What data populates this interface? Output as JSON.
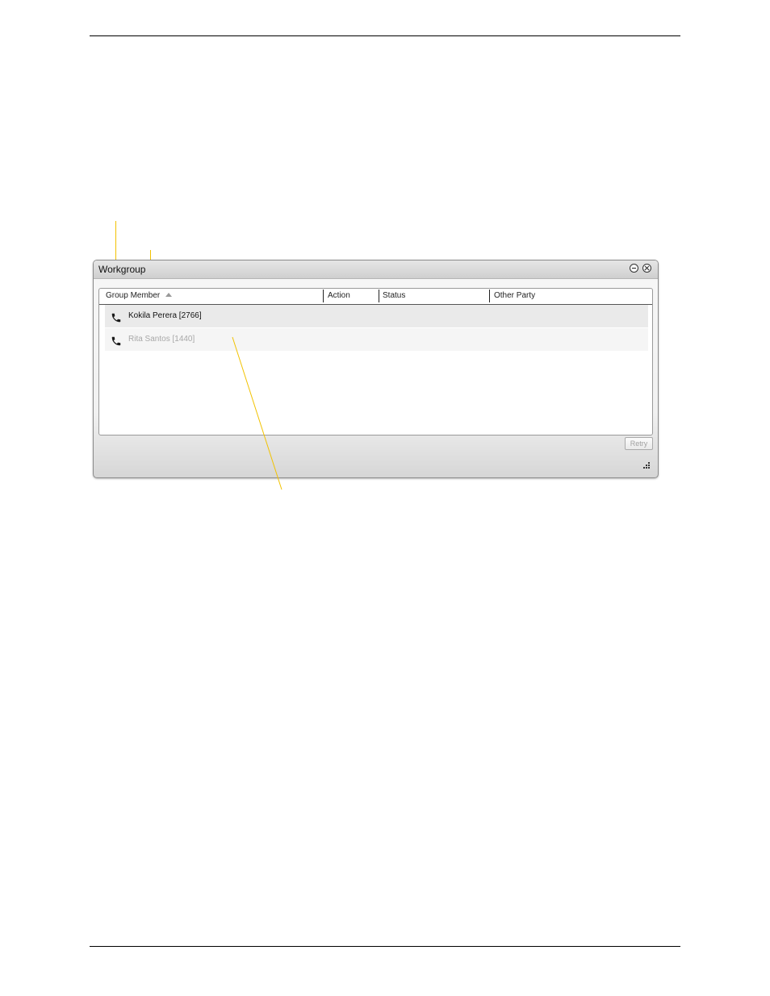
{
  "window": {
    "title": "Workgroup"
  },
  "table": {
    "columns": [
      "Group Member",
      "Action",
      "Status",
      "Other Party"
    ],
    "rows": [
      {
        "member": "Kokila Perera [2766]",
        "state": "active"
      },
      {
        "member": "Rita Santos [1440]",
        "state": "inactive"
      }
    ]
  },
  "footer": {
    "retry_label": "Retry"
  },
  "colors": {
    "callout_line": "#f2c200",
    "inactive_text": "#a8a8a8"
  }
}
